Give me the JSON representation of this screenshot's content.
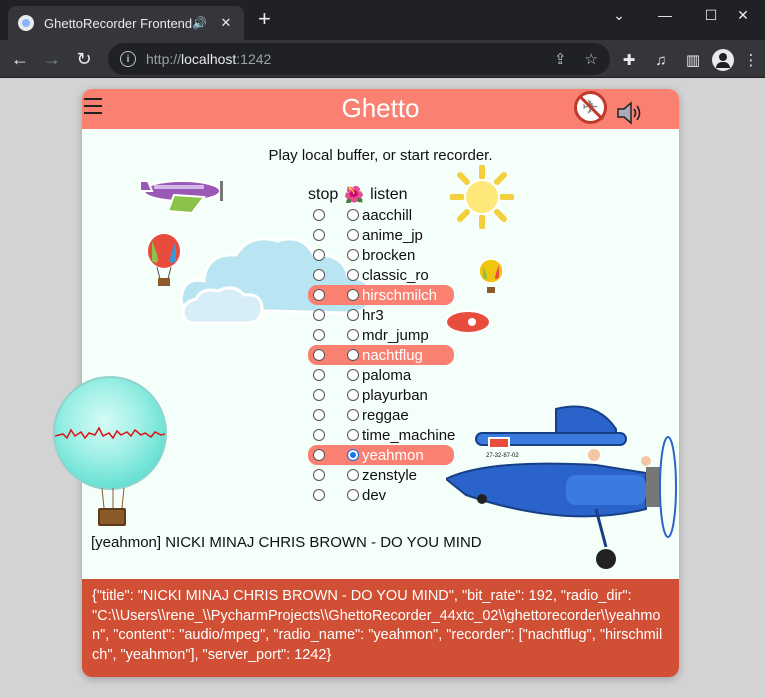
{
  "browser": {
    "tab_title": "GhettoRecorder Frontend",
    "url_scheme": "http://",
    "url_host": "localhost",
    "url_port": ":1242"
  },
  "app": {
    "title": "Ghetto",
    "intro": "Play local buffer, or start recorder.",
    "col_stop": "stop",
    "col_listen": "listen",
    "stations": [
      {
        "name": "aacchill",
        "recording": false,
        "listening": false
      },
      {
        "name": "anime_jp",
        "recording": false,
        "listening": false
      },
      {
        "name": "brocken",
        "recording": false,
        "listening": false
      },
      {
        "name": "classic_ro",
        "recording": false,
        "listening": false
      },
      {
        "name": "hirschmilch",
        "recording": true,
        "listening": false
      },
      {
        "name": "hr3",
        "recording": false,
        "listening": false
      },
      {
        "name": "mdr_jump",
        "recording": false,
        "listening": false
      },
      {
        "name": "nachtflug",
        "recording": true,
        "listening": false
      },
      {
        "name": "paloma",
        "recording": false,
        "listening": false
      },
      {
        "name": "playurban",
        "recording": false,
        "listening": false
      },
      {
        "name": "reggae",
        "recording": false,
        "listening": false
      },
      {
        "name": "time_machine",
        "recording": false,
        "listening": false
      },
      {
        "name": "yeahmon",
        "recording": true,
        "listening": true
      },
      {
        "name": "zenstyle",
        "recording": false,
        "listening": false
      },
      {
        "name": "dev",
        "recording": false,
        "listening": false
      }
    ],
    "now_playing": "[yeahmon] NICKI MINAJ CHRIS BROWN - DO YOU MIND",
    "json_info": "{\"title\": \"NICKI MINAJ CHRIS BROWN - DO YOU MIND\", \"bit_rate\": 192, \"radio_dir\": \"C:\\\\Users\\\\rene_\\\\PycharmProjects\\\\GhettoRecorder_44xtc_02\\\\ghettorecorder\\\\yeahmon\", \"content\": \"audio/mpeg\", \"radio_name\": \"yeahmon\", \"recorder\": [\"nachtflug\", \"hirschmilch\", \"yeahmon\"], \"server_port\": 1242}",
    "plane_label": "27-32-87-02"
  },
  "colors": {
    "header": "#fa8072",
    "json_bg": "#d14f34",
    "card_bg": "#f5fff9"
  }
}
